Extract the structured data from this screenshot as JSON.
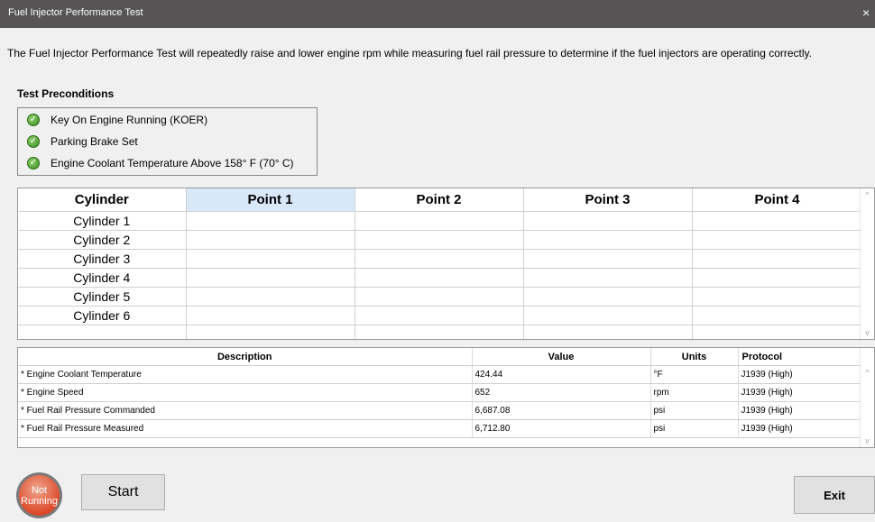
{
  "window": {
    "title": "Fuel Injector Performance Test",
    "close_glyph": "×"
  },
  "intro": "The Fuel Injector Performance Test will repeatedly raise and lower engine rpm while measuring fuel rail pressure to determine if the fuel injectors are operating correctly.",
  "preconditions": {
    "title": "Test Preconditions",
    "items": [
      {
        "label": "Key On Engine Running (KOER)",
        "status": "check-icon"
      },
      {
        "label": "Parking Brake Set",
        "status": "check-icon"
      },
      {
        "label": "Engine Coolant Temperature Above 158° F (70° C)",
        "status": "check-icon"
      }
    ]
  },
  "cylinder_table": {
    "headers": [
      "Cylinder",
      "Point 1",
      "Point 2",
      "Point 3",
      "Point 4"
    ],
    "selected_header": "Point 1",
    "rows": [
      "Cylinder 1",
      "Cylinder 2",
      "Cylinder 3",
      "Cylinder 4",
      "Cylinder 5",
      "Cylinder 6"
    ]
  },
  "data_table": {
    "headers": [
      "Description",
      "Value",
      "Units",
      "Protocol"
    ],
    "rows": [
      {
        "description": "* Engine Coolant Temperature",
        "value": "424.44",
        "units": "°F",
        "protocol": "J1939 (High)"
      },
      {
        "description": "* Engine Speed",
        "value": "652",
        "units": "rpm",
        "protocol": "J1939 (High)"
      },
      {
        "description": "* Fuel Rail Pressure Commanded",
        "value": "6,687.08",
        "units": "psi",
        "protocol": "J1939 (High)"
      },
      {
        "description": "* Fuel Rail Pressure Measured",
        "value": "6,712.80",
        "units": "psi",
        "protocol": "J1939 (High)"
      }
    ]
  },
  "status": {
    "line1": "Not",
    "line2": "Running",
    "color": "#dc4a2a"
  },
  "buttons": {
    "start": "Start",
    "exit": "Exit"
  },
  "scroll_glyphs": {
    "up": "^",
    "down": "v"
  }
}
